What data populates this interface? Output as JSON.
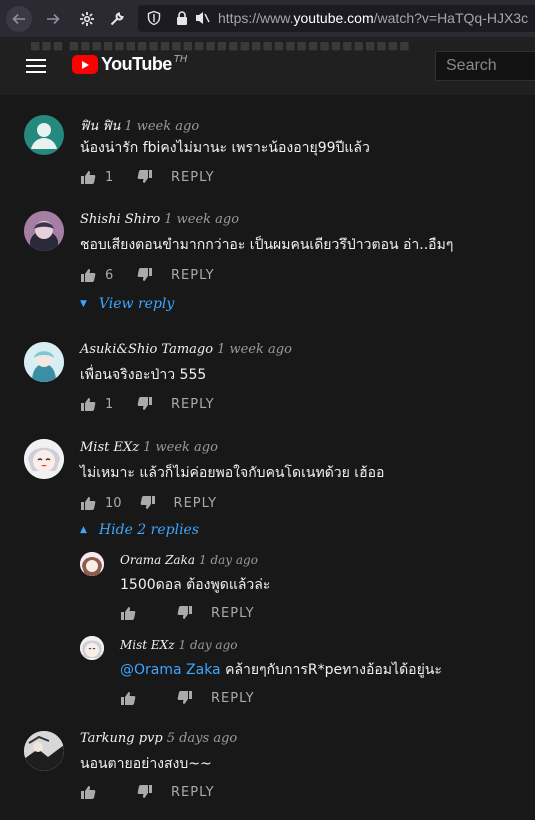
{
  "browser": {
    "url_prefix": "https://www.",
    "url_host": "youtube.com",
    "url_path": "/watch?v=HaTQq-HJX3c"
  },
  "header": {
    "logo_text": "YouTube",
    "logo_superscript": "TH",
    "search_placeholder": "Search",
    "ghost_text": "■■■ ■■■■■■■■■■■■■■■■■■■■■■■■■■■■■■"
  },
  "comments": [
    {
      "author": "ฟิน ฟิน",
      "time": "1 week ago",
      "text": "น้องน่ารัก fbiคงไม่มานะ เพราะน้องอายุ99ปีแล้ว",
      "likes": "1",
      "reply_label": "REPLY"
    },
    {
      "author": "Shishi Shiro",
      "time": "1 week ago",
      "text": "ชอบเสียงตอนขำมากกว่าอะ เป็นผมคนเดียวรึป่าวตอน อ่า..อืมๆ",
      "likes": "6",
      "reply_label": "REPLY",
      "toggle": "View reply"
    },
    {
      "author": "Asuki&Shio Tamago",
      "time": "1 week ago",
      "text": "เพื่อนจริงอะป่าว 555",
      "likes": "1",
      "reply_label": "REPLY"
    },
    {
      "author": "Mist EXz",
      "time": "1 week ago",
      "text": "ไม่เหมาะ แล้วก็ไม่ค่อยพอใจกับคนโดเนทด้วย เฮ้ออ",
      "likes": "10",
      "reply_label": "REPLY",
      "toggle": "Hide 2 replies"
    },
    {
      "author": "Tarkung pvp",
      "time": "5 days ago",
      "text": "นอนตายอย่างสงบ~~",
      "likes": "",
      "reply_label": "REPLY"
    }
  ],
  "replies": [
    {
      "author": "Orama Zaka",
      "time": "1 day ago",
      "text": "1500ดอล ต้องพูดแล้วล่ะ",
      "likes": "",
      "reply_label": "REPLY"
    },
    {
      "author": "Mist EXz",
      "time": "1 day ago",
      "mention": "@Orama Zaka",
      "text": " คล้ายๆกับการR*peทางอ้อมได้อยู่นะ",
      "likes": "",
      "reply_label": "REPLY"
    }
  ],
  "colors": {
    "link": "#3ea6ff",
    "background": "#181818",
    "header": "#202020",
    "logo_red": "#ff0000"
  }
}
